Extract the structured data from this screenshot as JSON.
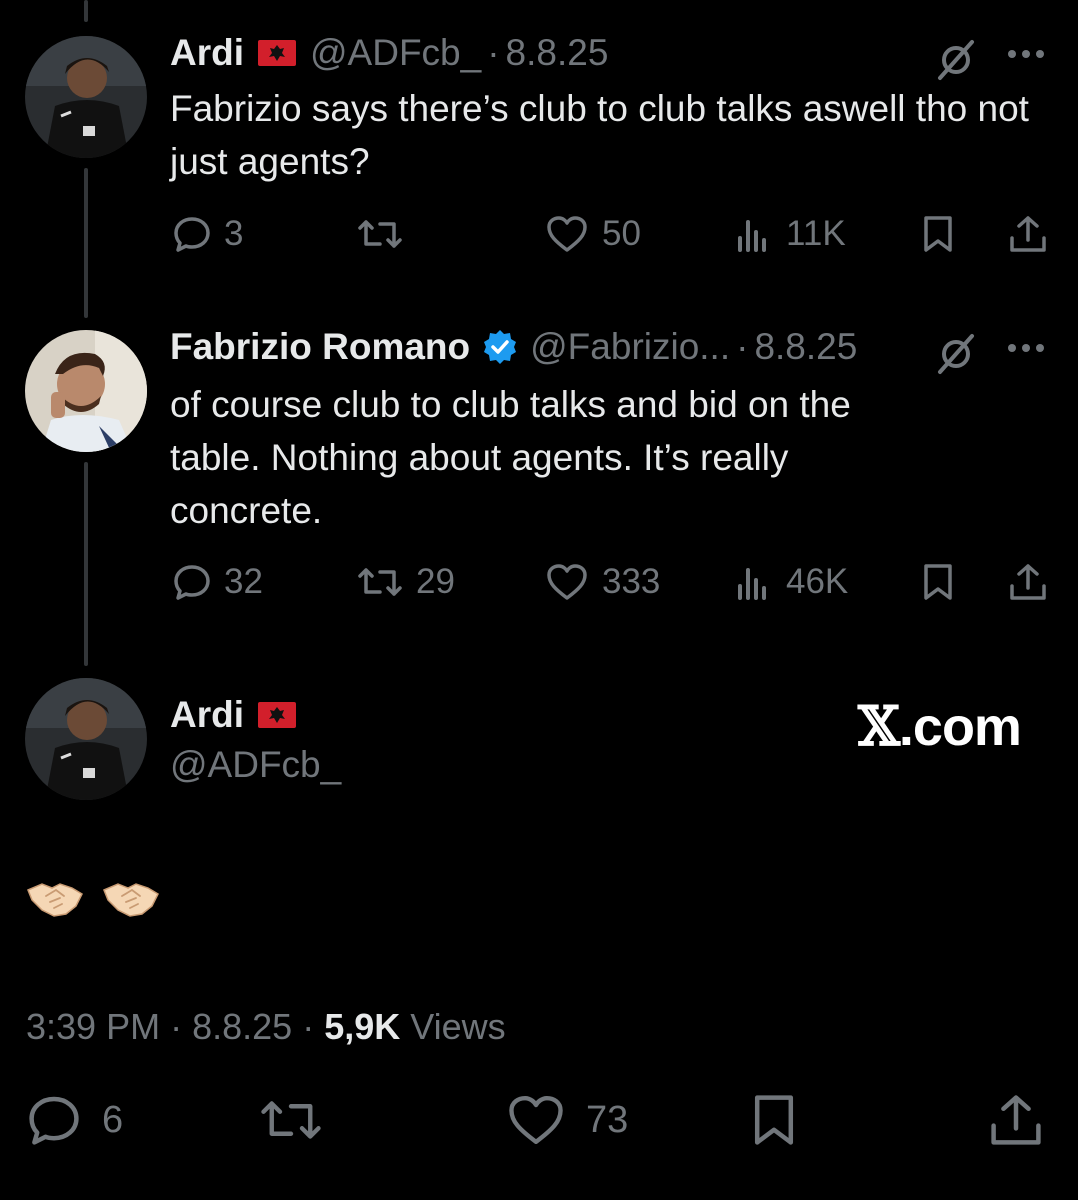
{
  "tweets": [
    {
      "name": "Ardi",
      "handle": "@ADFcb_",
      "separator": "·",
      "date": "8.8.25",
      "text": "Fabrizio says there’s club to club talks aswell tho not just agents?",
      "actions": {
        "replies": "3",
        "reposts": "",
        "likes": "50",
        "views": "11K"
      }
    },
    {
      "name": "Fabrizio Romano",
      "handle": "@Fabrizio...",
      "separator": "·",
      "date": "8.8.25",
      "text": "of course club to club talks and bid on the table. Nothing about agents. It’s really concrete.",
      "actions": {
        "replies": "32",
        "reposts": "29",
        "likes": "333",
        "views": "46K"
      }
    }
  ],
  "main_tweet": {
    "name": "Ardi",
    "handle": "@ADFcb_",
    "emoji_text": "🤝🏻🤝🏻",
    "time": "3:39 PM",
    "separator": "·",
    "date": "8.8.25",
    "views_count": "5,9K",
    "views_label": "Views",
    "actions": {
      "replies": "6",
      "reposts": "",
      "likes": "73"
    }
  },
  "watermark": {
    "x": "𝕏",
    "domain": ".com"
  },
  "colors": {
    "background": "#000000",
    "text": "#e7e9ea",
    "muted": "#71767b",
    "verified": "#1d9bf0",
    "albania_red": "#d21f2b"
  },
  "icons": [
    "reply-icon",
    "repost-icon",
    "like-icon",
    "views-icon",
    "bookmark-icon",
    "share-icon",
    "grok-icon",
    "more-icon",
    "verified-badge-icon",
    "albania-flag-icon"
  ]
}
